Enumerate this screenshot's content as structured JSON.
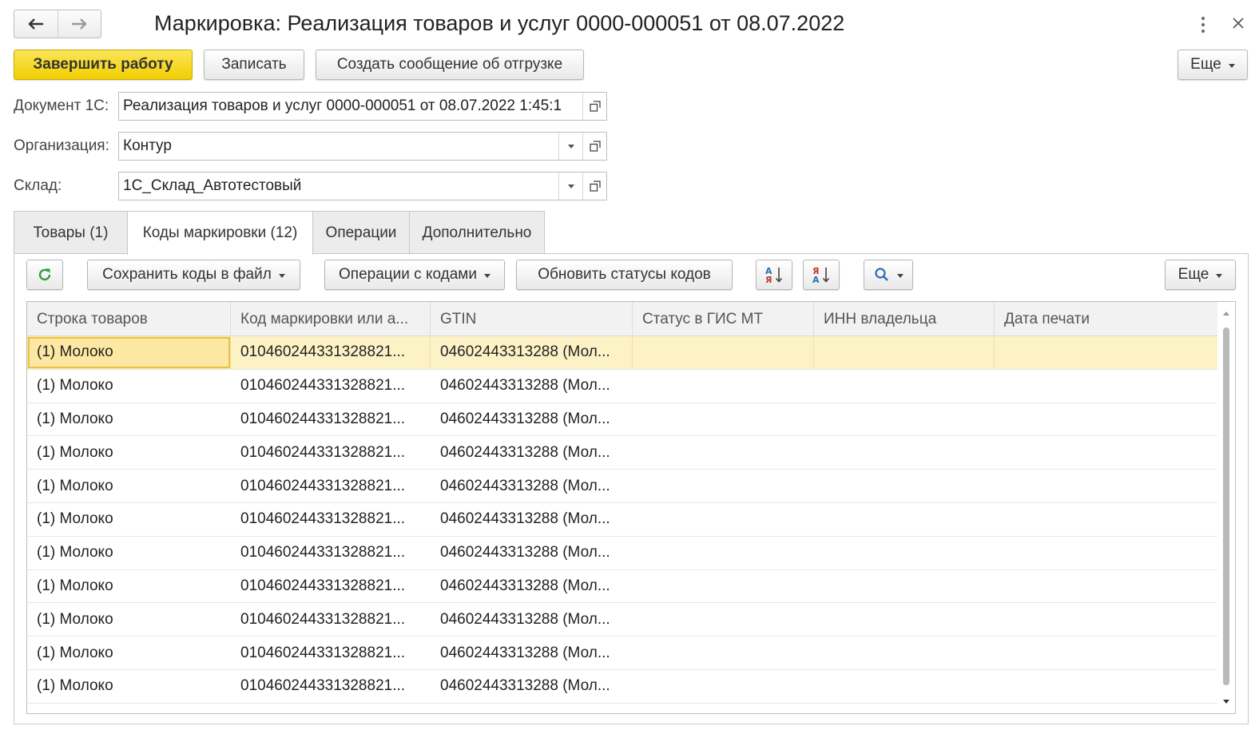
{
  "window": {
    "title": "Маркировка: Реализация товаров и услуг 0000-000051 от 08.07.2022",
    "back_icon": "arrow-left-icon",
    "forward_icon": "arrow-right-icon"
  },
  "toolbar": {
    "finish_label": "Завершить работу",
    "save_label": "Записать",
    "create_message_label": "Создать сообщение об отгрузке",
    "more_label": "Еще"
  },
  "form": {
    "document_label": "Документ 1С:",
    "document_value": "Реализация товаров и услуг 0000-000051 от 08.07.2022 1:45:1",
    "organization_label": "Организация:",
    "organization_value": "Контур",
    "warehouse_label": "Склад:",
    "warehouse_value": "1С_Склад_Автотестовый"
  },
  "tabs": [
    {
      "label": "Товары (1)",
      "active": false
    },
    {
      "label": "Коды маркировки (12)",
      "active": true
    },
    {
      "label": "Операции",
      "active": false
    },
    {
      "label": "Дополнительно",
      "active": false
    }
  ],
  "codes_toolbar": {
    "save_codes_label": "Сохранить коды в файл",
    "code_ops_label": "Операции с кодами",
    "update_status_label": "Обновить статусы кодов",
    "more_label": "Еще"
  },
  "table": {
    "columns": [
      "Строка товаров",
      "Код маркировки или а...",
      "GTIN",
      "Статус в ГИС МТ",
      "ИНН владельца",
      "Дата печати"
    ],
    "rows": [
      [
        "(1) Молоко",
        "010460244331328821...",
        "04602443313288 (Мол...",
        "",
        "",
        ""
      ],
      [
        "(1) Молоко",
        "010460244331328821...",
        "04602443313288 (Мол...",
        "",
        "",
        ""
      ],
      [
        "(1) Молоко",
        "010460244331328821...",
        "04602443313288 (Мол...",
        "",
        "",
        ""
      ],
      [
        "(1) Молоко",
        "010460244331328821...",
        "04602443313288 (Мол...",
        "",
        "",
        ""
      ],
      [
        "(1) Молоко",
        "010460244331328821...",
        "04602443313288 (Мол...",
        "",
        "",
        ""
      ],
      [
        "(1) Молоко",
        "010460244331328821...",
        "04602443313288 (Мол...",
        "",
        "",
        ""
      ],
      [
        "(1) Молоко",
        "010460244331328821...",
        "04602443313288 (Мол...",
        "",
        "",
        ""
      ],
      [
        "(1) Молоко",
        "010460244331328821...",
        "04602443313288 (Мол...",
        "",
        "",
        ""
      ],
      [
        "(1) Молоко",
        "010460244331328821...",
        "04602443313288 (Мол...",
        "",
        "",
        ""
      ],
      [
        "(1) Молоко",
        "010460244331328821...",
        "04602443313288 (Мол...",
        "",
        "",
        ""
      ],
      [
        "(1) Молоко",
        "010460244331328821...",
        "04602443313288 (Мол...",
        "",
        "",
        ""
      ]
    ],
    "selected_row": 0
  },
  "colors": {
    "primary_button": "#f1cf00",
    "selected_row": "#fdf2c5",
    "refresh_icon": "#2e9e3c",
    "search_icon": "#2a6fb8",
    "sort_red": "#c0392b",
    "sort_blue": "#2a6fb8"
  }
}
